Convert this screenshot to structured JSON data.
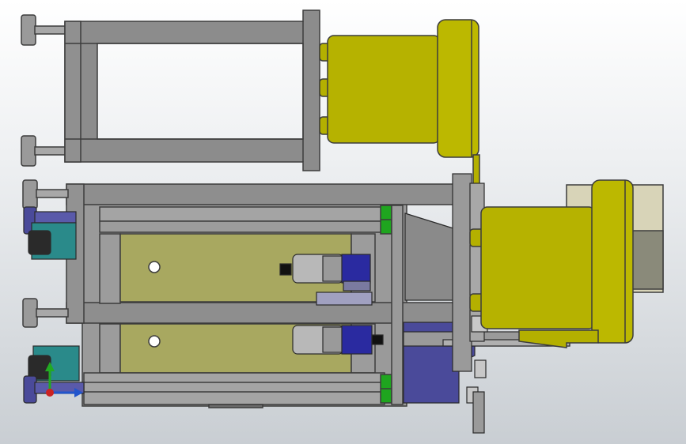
{
  "viewport": {
    "background_top": "#ffffff",
    "background_bottom": "#c9ced3"
  },
  "model": {
    "frame_color": "#8a8a8a",
    "frame_edge": "#3c3c3c",
    "motor_color": "#b4b000",
    "plate_color": "#a8a860",
    "mount_color": "#4a4a9a",
    "clamp_color": "#2a8a8a",
    "highlight_color": "#1fa51f",
    "guard_color": "#d8d4b8"
  },
  "triad": {
    "x_axis_color": "#cc2222",
    "y_axis_color": "#22aa22",
    "origin_color": "#2255cc"
  }
}
